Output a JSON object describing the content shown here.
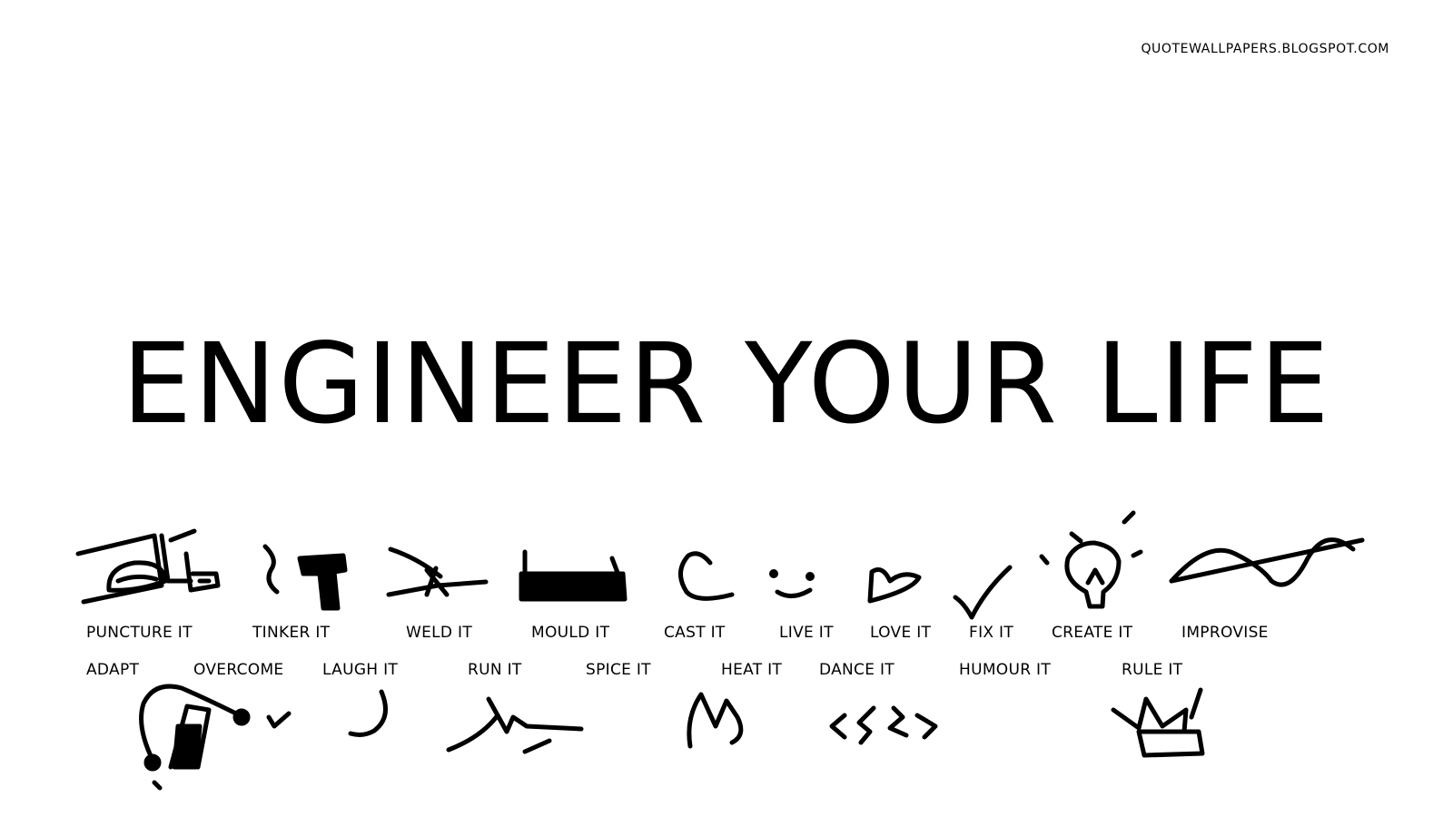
{
  "source": "QUOTEWALLPAPERS.BLOGSPOT.COM",
  "headline": "ENGINEER YOUR LIFE",
  "top_labels": [
    "PUNCTURE IT",
    "TINKER IT",
    "WELD IT",
    "MOULD IT",
    "CAST IT",
    "LIVE IT",
    "LOVE IT",
    "FIX IT",
    "CREATE IT",
    "IMPROVISE"
  ],
  "bottom_labels": [
    "ADAPT",
    "OVERCOME",
    "LAUGH IT",
    "RUN IT",
    "SPICE IT",
    "HEAT IT",
    "DANCE IT",
    "HUMOUR IT",
    "RULE IT"
  ],
  "doodle_icons": [
    "bicycle-pump-icon",
    "hammer-icon",
    "welding-torch-icon",
    "mould-tray-icon",
    "cast-hook-icon",
    "smile-icon",
    "heart-icon",
    "checkmark-icon",
    "lightbulb-icon",
    "sine-wave-icon",
    "bell-cone-icon",
    "laugh-mouth-icon",
    "running-figure-icon",
    "chili-pepper-icon",
    "flame-icon",
    "dance-zigzag-icon",
    "crown-icon"
  ]
}
